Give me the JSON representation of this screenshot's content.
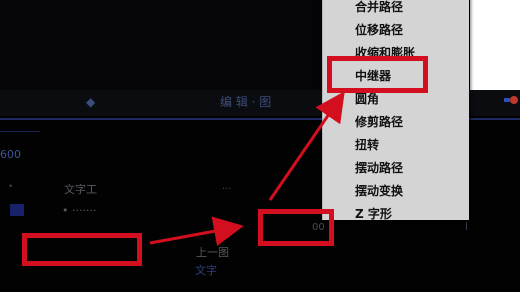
{
  "background": {
    "tabs": [
      "◆",
      "编 辑 · 图"
    ],
    "number": "600",
    "row_text_1": "文字工",
    "row_text_2": "• ·······",
    "row_text_3": "上一图",
    "label_blue": "文字",
    "small_1": "···",
    "small_2": "00"
  },
  "context_menu": {
    "items": [
      "合并路径",
      "位移路径",
      "收缩和膨胀",
      "中继器",
      "圆角",
      "修剪路径",
      "扭转",
      "摆动路径",
      "摆动变换",
      "Z 字形"
    ],
    "highlighted_item": "中继器"
  },
  "colors": {
    "annotation_red": "#d30f1f",
    "menu_background": "#d4d4d4",
    "screen_background": "#020203"
  }
}
